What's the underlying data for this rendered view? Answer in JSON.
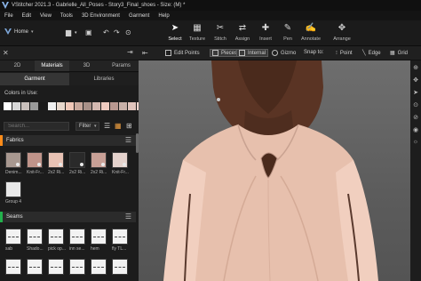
{
  "window": {
    "title": "VStitcher 2021.3 - Gabrielle_All_Poses - Story3_Final_shoes - Size: (M) *"
  },
  "menu": [
    "File",
    "Edit",
    "View",
    "Tools",
    "3D Environment",
    "Garment",
    "Help"
  ],
  "toolbar": {
    "home_label": "Home",
    "tools": [
      {
        "label": "Select",
        "icon": "cursor-icon",
        "glyph": "➤"
      },
      {
        "label": "Texture",
        "icon": "texture-icon",
        "glyph": "▦"
      },
      {
        "label": "Stitch",
        "icon": "stitch-icon",
        "glyph": "✂"
      },
      {
        "label": "Assign",
        "icon": "assign-icon",
        "glyph": "⇄"
      },
      {
        "label": "Insert",
        "icon": "insert-icon",
        "glyph": "✚"
      },
      {
        "label": "Pen",
        "icon": "pen-icon",
        "glyph": "✎"
      },
      {
        "label": "Annotate",
        "icon": "annotate-icon",
        "glyph": "✍"
      },
      {
        "label": "Arrange",
        "icon": "arrange-icon",
        "glyph": "✥"
      }
    ]
  },
  "left_panel": {
    "tabs": [
      "2D",
      "Materials",
      "3D",
      "Params"
    ],
    "active_tab": "Materials",
    "subtabs": [
      "Garment",
      "Libraries"
    ],
    "active_subtab": "Garment",
    "colors_label": "Colors in Use:",
    "colors": [
      "#ffffff",
      "#d8d8d8",
      "#c9c0bc",
      "#9a9a9a",
      "#1a1a1a",
      "#f0f0f0",
      "#e8d8cc",
      "#f0c8b8",
      "#c8a89c",
      "#a89088",
      "#d4b8b0",
      "#eecbc0",
      "#b89890",
      "#c8b0a8",
      "#e0c4bc",
      "#f4d4cc"
    ],
    "search_placeholder": "Search...",
    "filter_label": "Filter",
    "fabrics": {
      "title": "Fabrics",
      "accent": "#ff8c1a",
      "items": [
        {
          "caption": "Denim...",
          "color": "#a89890"
        },
        {
          "caption": "Knit-Fr...",
          "color": "#c0948a"
        },
        {
          "caption": "2x2 Ri...",
          "color": "#e8c2b4"
        },
        {
          "caption": "2x2 Ri...",
          "color": "#2a2a2a"
        },
        {
          "caption": "2x2 Ri...",
          "color": "#c8a096"
        },
        {
          "caption": "Knit-Fr...",
          "color": "#e4d2cc"
        },
        {
          "caption": "Group 4",
          "color": "#e8e8e8"
        }
      ]
    },
    "seams": {
      "title": "Seams",
      "accent": "#22b14c",
      "items": [
        {
          "caption": "sab"
        },
        {
          "caption": "Shado..."
        },
        {
          "caption": "pick op..."
        },
        {
          "caption": "inn se..."
        },
        {
          "caption": "hem"
        },
        {
          "caption": "fly TL..."
        }
      ]
    }
  },
  "viewport": {
    "edit_points_label": "Edit Points",
    "pieces_label": "Pieces",
    "internal_label": "Internal",
    "gizmo_label": "Gizmo",
    "snap_label": "Snap to:",
    "point_label": "Point",
    "edge_label": "Edge",
    "grid_label": "Grid"
  }
}
